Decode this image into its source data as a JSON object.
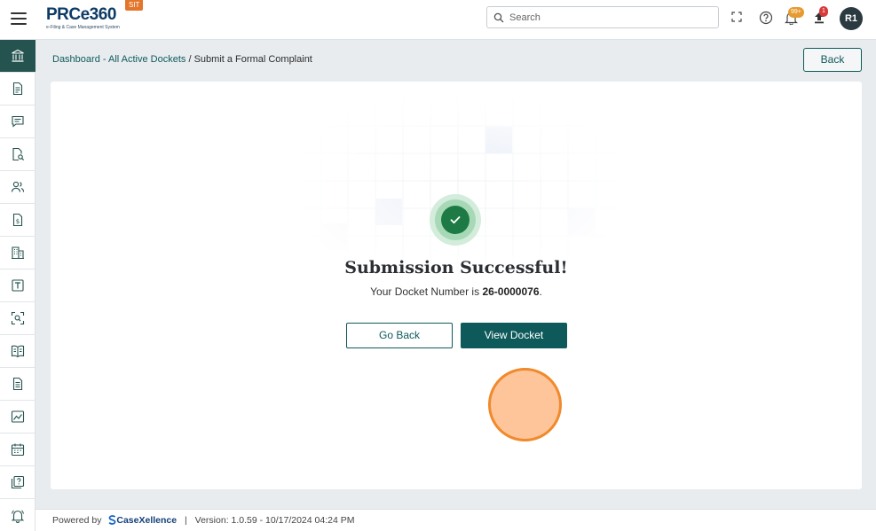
{
  "header": {
    "logo_text": "PRCe360",
    "logo_subtitle": "e-Filing & Case Management System",
    "env_badge": "SIT",
    "search_placeholder": "Search",
    "notifications_badge": "99+",
    "uploads_badge": "1",
    "avatar_initials": "R1"
  },
  "sidebar": {
    "items": [
      {
        "icon": "institution-icon",
        "active": true
      },
      {
        "icon": "document-icon"
      },
      {
        "icon": "chat-icon"
      },
      {
        "icon": "document-search-icon"
      },
      {
        "icon": "users-icon"
      },
      {
        "icon": "invoice-icon"
      },
      {
        "icon": "building-icon"
      },
      {
        "icon": "text-box-icon"
      },
      {
        "icon": "scan-icon"
      },
      {
        "icon": "book-icon"
      },
      {
        "icon": "page-icon"
      },
      {
        "icon": "chart-image-icon"
      },
      {
        "icon": "calendar-icon"
      },
      {
        "icon": "help-document-icon"
      },
      {
        "icon": "bell-icon"
      }
    ]
  },
  "breadcrumb": {
    "link": "Dashboard - All Active Dockets",
    "separator": "/",
    "current": "Submit a Formal Complaint"
  },
  "back_label": "Back",
  "success": {
    "title": "Submission Successful!",
    "docket_prefix": "Your Docket Number is",
    "docket_number": "26-0000076",
    "docket_suffix": ".",
    "go_back_label": "Go Back",
    "view_docket_label": "View Docket"
  },
  "footer": {
    "powered_by": "Powered by",
    "brand": "CaseXellence",
    "separator": "|",
    "version": "Version: 1.0.59 - 10/17/2024 04:24 PM"
  },
  "colors": {
    "primary": "#0e5a5a",
    "success": "#1d7a45",
    "badge_orange": "#e69a2f",
    "badge_red": "#d83a3a",
    "env_badge": "#e4762b"
  }
}
